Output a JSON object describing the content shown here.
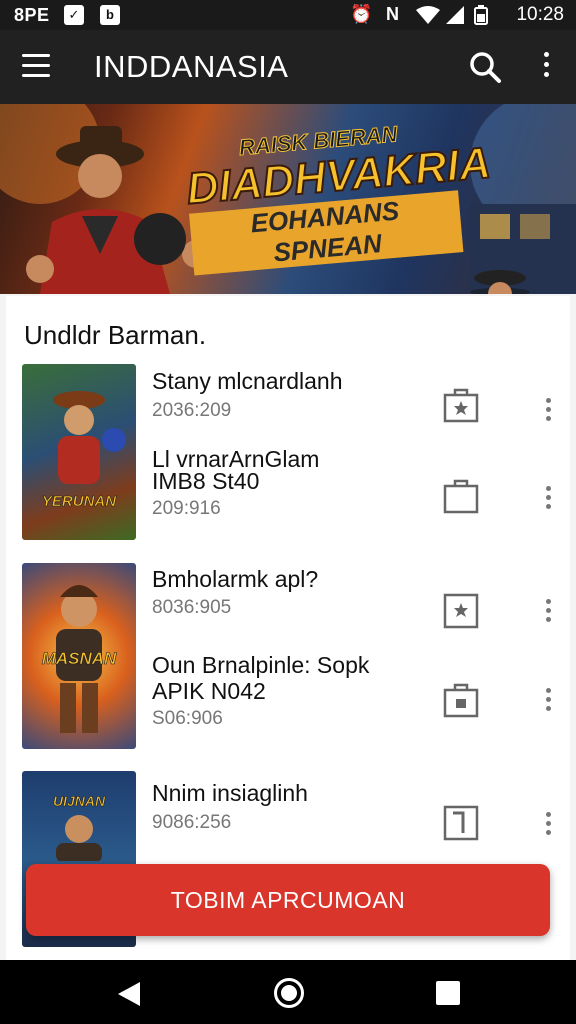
{
  "status_bar": {
    "left_text": "8PE",
    "time": "10:28"
  },
  "app_bar": {
    "title": "INDDANASIA"
  },
  "banner": {
    "line1": "RAISK BIERAN",
    "line2": "DIADHVAKRIA",
    "line3": "EOHANANS SPNEAN"
  },
  "section": {
    "title": "Undldr Barman."
  },
  "thumbnails": [
    {
      "label": "YERUNAN"
    },
    {
      "label": "MASNAN"
    },
    {
      "label": "UIJNAN"
    }
  ],
  "items": [
    {
      "title": "Stany mlcnardlanh",
      "meta": "2036:209"
    },
    {
      "title": "Ll vrnarArnGlam",
      "subtitle": "IMB8 St40",
      "meta": "209:916"
    },
    {
      "title": "Bmholarmk apl?",
      "meta": "8036:905"
    },
    {
      "title": "Oun Brnalpinle: Sopk",
      "subtitle": "APIK N042",
      "meta": "S06:906"
    },
    {
      "title": "Nnim insiaglinh",
      "meta": "9086:256"
    }
  ],
  "action_button": {
    "label": "TOBIM APRCUMOAN"
  },
  "colors": {
    "app_bar": "#212121",
    "accent": "#d9352b"
  }
}
